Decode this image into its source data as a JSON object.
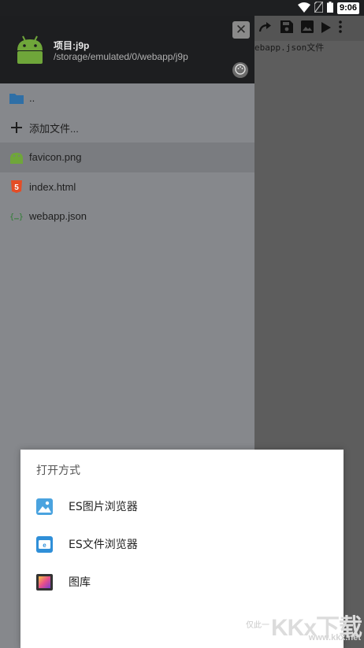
{
  "status_bar": {
    "time": "9:06",
    "icons": [
      "wifi-icon",
      "sim-icon",
      "battery-icon"
    ]
  },
  "editor": {
    "visible_text": "ebapp.json文件",
    "toolbar_icons": [
      "redo-icon",
      "save-icon",
      "image-icon",
      "play-icon",
      "more-vert-icon"
    ]
  },
  "drawer": {
    "project_title": "项目:j9p",
    "project_path": "/storage/emulated/0/webapp/j9p",
    "close_icon": "close-icon",
    "palette_icon": "palette-icon",
    "items": [
      {
        "label": "..",
        "icon": "folder-icon",
        "selected": false
      },
      {
        "label": "添加文件...",
        "icon": "plus-icon",
        "selected": false
      },
      {
        "label": "favicon.png",
        "icon": "android-image-icon",
        "selected": true
      },
      {
        "label": "index.html",
        "icon": "html5-icon",
        "selected": false
      },
      {
        "label": "webapp.json",
        "icon": "json-braces-icon",
        "selected": false
      }
    ]
  },
  "dialog": {
    "title": "打开方式",
    "options": [
      {
        "label": "ES图片浏览器",
        "icon": "es-image-browser-icon"
      },
      {
        "label": "ES文件浏览器",
        "icon": "es-file-browser-icon"
      },
      {
        "label": "图库",
        "icon": "gallery-icon"
      }
    ]
  },
  "watermark": {
    "note": "仅此一",
    "brand": "KKx下载",
    "url": "www.kkx.net"
  },
  "colors": {
    "drawer_header": "#1d1e20",
    "drawer_body": "#86888c",
    "selected_row": "#7a7c80",
    "dialog_bg": "#ffffff",
    "android_green": "#6fa63a",
    "html5_orange": "#e44d26",
    "folder_blue": "#2f6fa6",
    "json_green": "#2e7d32"
  }
}
